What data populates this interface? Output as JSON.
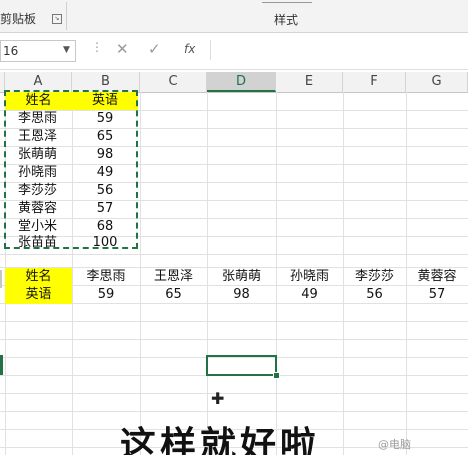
{
  "ribbon": {
    "clipboard_label": "剪贴板",
    "clipboard_launcher": "↘",
    "styles_label": "样式"
  },
  "formula_bar": {
    "name_box_value": "16",
    "cancel_icon": "✕",
    "enter_icon": "✓",
    "fx_label": "fx",
    "formula_value": ""
  },
  "columns": [
    "A",
    "B",
    "C",
    "D",
    "E",
    "F",
    "G"
  ],
  "selected_column": "D",
  "table1": {
    "header": [
      "姓名",
      "英语"
    ],
    "rows": [
      [
        "李思雨",
        "59"
      ],
      [
        "王恩泽",
        "65"
      ],
      [
        "张萌萌",
        "98"
      ],
      [
        "孙晓雨",
        "49"
      ],
      [
        "李莎莎",
        "56"
      ],
      [
        "黄蓉容",
        "57"
      ],
      [
        "堂小米",
        "68"
      ],
      [
        "张苗苗",
        "100"
      ]
    ]
  },
  "table2": {
    "name_label": "姓名",
    "score_label": "英语",
    "names": [
      "李思雨",
      "王恩泽",
      "张萌萌",
      "孙晓雨",
      "李莎莎",
      "黄蓉容"
    ],
    "scores": [
      "59",
      "65",
      "98",
      "49",
      "56",
      "57"
    ]
  },
  "subtitle": "这样就好啦",
  "watermark": "@电脑",
  "colors": {
    "excel_green": "#217346",
    "header_yellow": "#ffff00"
  }
}
